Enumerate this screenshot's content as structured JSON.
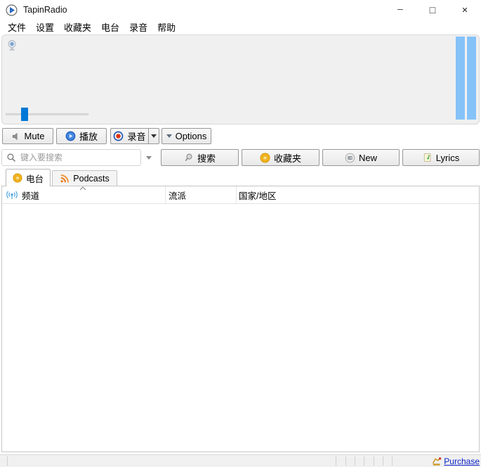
{
  "window": {
    "title": "TapinRadio",
    "controls": {
      "minimize": "─",
      "maximize": "□",
      "close": "✕"
    }
  },
  "menu": {
    "items": [
      "文件",
      "设置",
      "收藏夹",
      "电台",
      "录音",
      "帮助"
    ]
  },
  "player": {
    "volume_percent": 19,
    "vu_bars": 2
  },
  "toolbar": {
    "mute": "Mute",
    "play": "播放",
    "record": "录音",
    "options": "Options"
  },
  "search": {
    "placeholder": "键入要搜索",
    "value": ""
  },
  "actions": {
    "search": "搜索",
    "favorites": "收藏夹",
    "new": "New",
    "lyrics": "Lyrics"
  },
  "tabs": {
    "stations": "电台",
    "podcasts": "Podcasts"
  },
  "table": {
    "columns": [
      "频道",
      "流派",
      "国家/地区"
    ],
    "sort_column": "频道",
    "sort_direction": "ascending",
    "rows": []
  },
  "statusbar": {
    "purchase": "Purchase"
  },
  "colors": {
    "accent-blue": "#0078d7",
    "vu-bar": "#85c2f8",
    "panel-bg": "#f0f0f0",
    "link": "#0a23c8",
    "rss-orange": "#e87d1e",
    "star-gold": "#f5b51e",
    "record-red": "#e03018",
    "broadcast-blue": "#44a0dc"
  },
  "icons": {
    "app-icon": "play-triangle-in-circle",
    "mute-icon": "gray-speaker",
    "play-icon": "blue-play-circle",
    "record-icon": "blue-ring-red-dot",
    "search-icon": "magnifier",
    "favorites-icon": "gold-star-in-circle",
    "new-icon": "gray-circle-radio",
    "lyrics-icon": "document-green-note",
    "stations-tab-icon": "gold-star-in-circle",
    "podcasts-icon": "orange-rss",
    "channel-icon": "blue-broadcast-antenna",
    "radio-icon": "gray-microphone",
    "purchase-icon": "colored-cart"
  }
}
